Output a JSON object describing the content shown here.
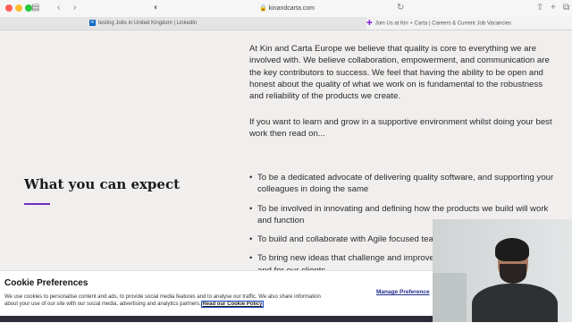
{
  "browser": {
    "address": "kinandcarta.com",
    "tabs": [
      {
        "label": "testing Jobs in United Kingdom | LinkedIn",
        "favicon": "linkedin-icon"
      },
      {
        "label": "Join Us at Kin + Carta | Careers & Current Job Vacancies",
        "favicon": "kin-carta-icon"
      }
    ]
  },
  "intro": {
    "paragraph1": "At Kin and Carta Europe we believe that quality is core to everything we are involved with. We believe collaboration, empowerment, and communication are the key contributors to success. We feel that having the ability to be open and honest about the quality of what we work on is fundamental to the robustness and reliability of the products we create.",
    "paragraph2": "If you want to learn and grow in a supportive environment whilst doing your best work then read on..."
  },
  "expect": {
    "title": "What you can expect",
    "items": [
      "To be a dedicated advocate of delivering quality software, and supporting your colleagues in doing the same",
      "To be involved in innovating and defining how the products we build will work and function",
      "To build and collaborate with Agile focused tea",
      "To bring  new ideas that challenge and improve",
      "and for our clients"
    ]
  },
  "cookie": {
    "title": "Cookie Preferences",
    "text": "We use cookies to personalise content and ads, to provide social media features and to analyse our traffic. We also share information about your use of our site with our social media, advertising and analytics partners.",
    "link": "Read our Cookie Policy",
    "manage": "Manage Preference"
  },
  "colors": {
    "accent": "#6b2fbf",
    "background": "#f1efee",
    "link": "#1e2a8a"
  }
}
